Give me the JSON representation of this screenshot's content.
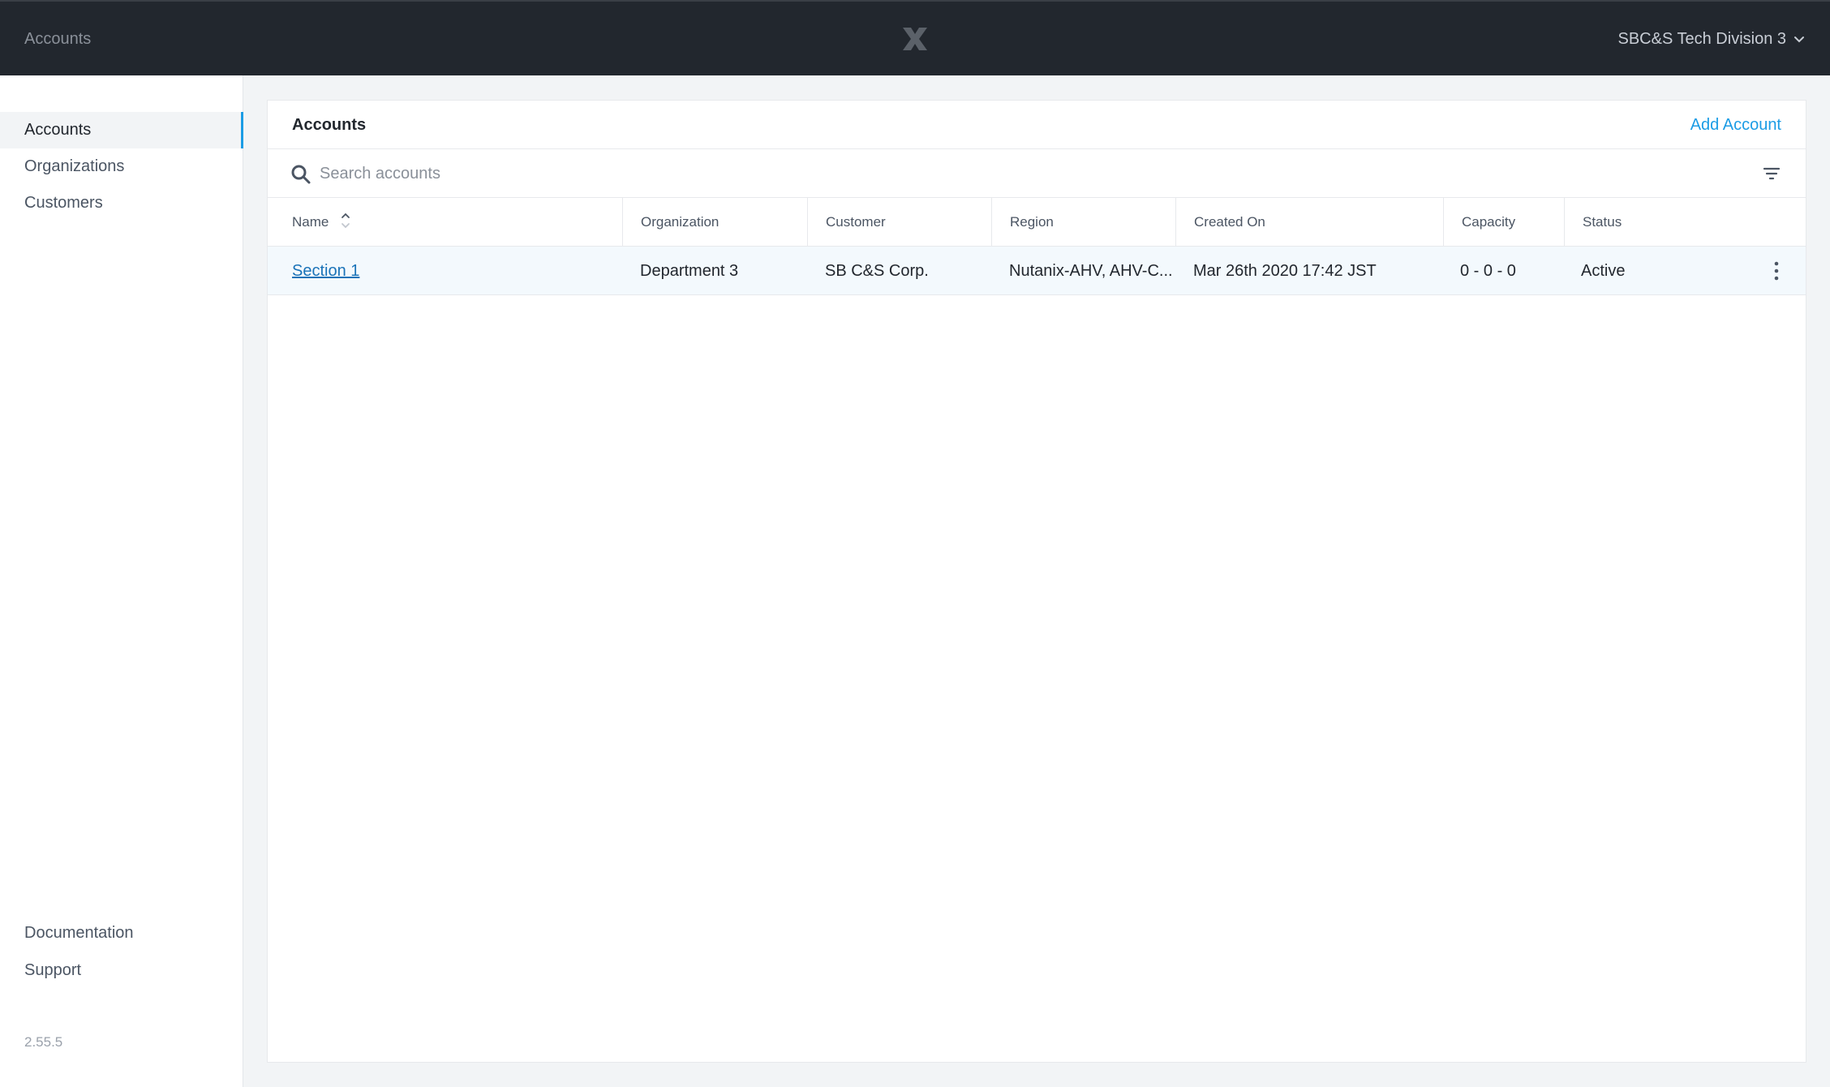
{
  "topbar": {
    "app_title": "Accounts",
    "logo_icon": "nutanix-x-icon",
    "tenant_label": "SBC&S Tech Division 3",
    "tenant_icon": "chevron-down-icon"
  },
  "sidebar": {
    "items": [
      {
        "label": "Accounts",
        "active": true
      },
      {
        "label": "Organizations",
        "active": false
      },
      {
        "label": "Customers",
        "active": false
      }
    ],
    "footer": {
      "documentation": "Documentation",
      "support": "Support",
      "version": "2.55.5"
    }
  },
  "main": {
    "title": "Accounts",
    "add_label": "Add Account",
    "search": {
      "placeholder": "Search accounts",
      "value": ""
    },
    "columns": [
      "Name",
      "Organization",
      "Customer",
      "Region",
      "Created On",
      "Capacity",
      "Status"
    ],
    "sort": {
      "column": "Name",
      "direction": "ascending"
    },
    "rows": [
      {
        "name": "Section 1",
        "organization": "Department 3",
        "customer": "SB C&S Corp.",
        "region": "Nutanix-AHV, AHV-C...",
        "created_on": "Mar 26th 2020 17:42 JST",
        "capacity": "0 - 0 - 0",
        "status": "Active"
      }
    ]
  },
  "colors": {
    "topbar_bg": "#22272e",
    "accent": "#1b9ce5",
    "link": "#1a73b8",
    "row_highlight": "#f3f9fd",
    "page_bg": "#f2f4f6"
  }
}
